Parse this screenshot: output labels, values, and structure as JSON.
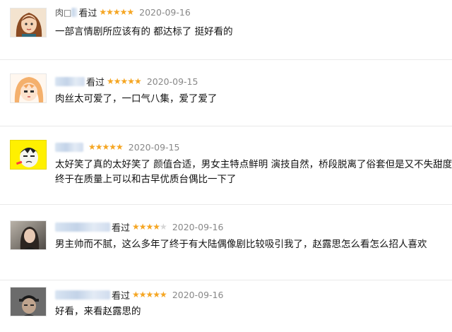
{
  "reviews": [
    {
      "name_visible": "肉□",
      "action": "看过",
      "stars": "★★★★★",
      "stars_empty": "",
      "date": "2020-09-16",
      "lines": [
        "一部言情剧所应该有的 都达标了 挺好看的"
      ],
      "avatar_icon": "cartoon-girl-brown-hair-icon"
    },
    {
      "name_visible": "",
      "action": "看过",
      "stars": "★★★★★",
      "stars_empty": "",
      "date": "2020-09-15",
      "lines": [
        "肉丝太可爱了，一口气八集，爱了爱了"
      ],
      "avatar_icon": "anime-girl-orange-hair-icon"
    },
    {
      "name_visible": "",
      "action": "",
      "stars": "★★★★★",
      "stars_empty": "",
      "date": "2020-09-15",
      "lines": [
        "太好笑了真的太好笑了 颜值合适，男女主特点鲜明 演技自然，桥段脱离了俗套但是又不失甜度，",
        "终于在质量上可以和古早优质台偶比一下了"
      ],
      "avatar_icon": "cartoon-face-yellow-icon"
    },
    {
      "name_visible": "",
      "action": "看过",
      "stars": "★★★★",
      "stars_empty": "★",
      "date": "2020-09-16",
      "lines": [
        "男主帅而不腻，这么多年了终于有大陆偶像剧比较吸引我了，赵露思怎么看怎么招人喜欢"
      ],
      "avatar_icon": "photo-woman-icon"
    },
    {
      "name_visible": "",
      "action": "看过",
      "stars": "★★★★★",
      "stars_empty": "",
      "date": "2020-09-16",
      "lines": [
        "好看，来看赵露思的"
      ],
      "avatar_icon": "photo-man-cap-icon"
    }
  ]
}
